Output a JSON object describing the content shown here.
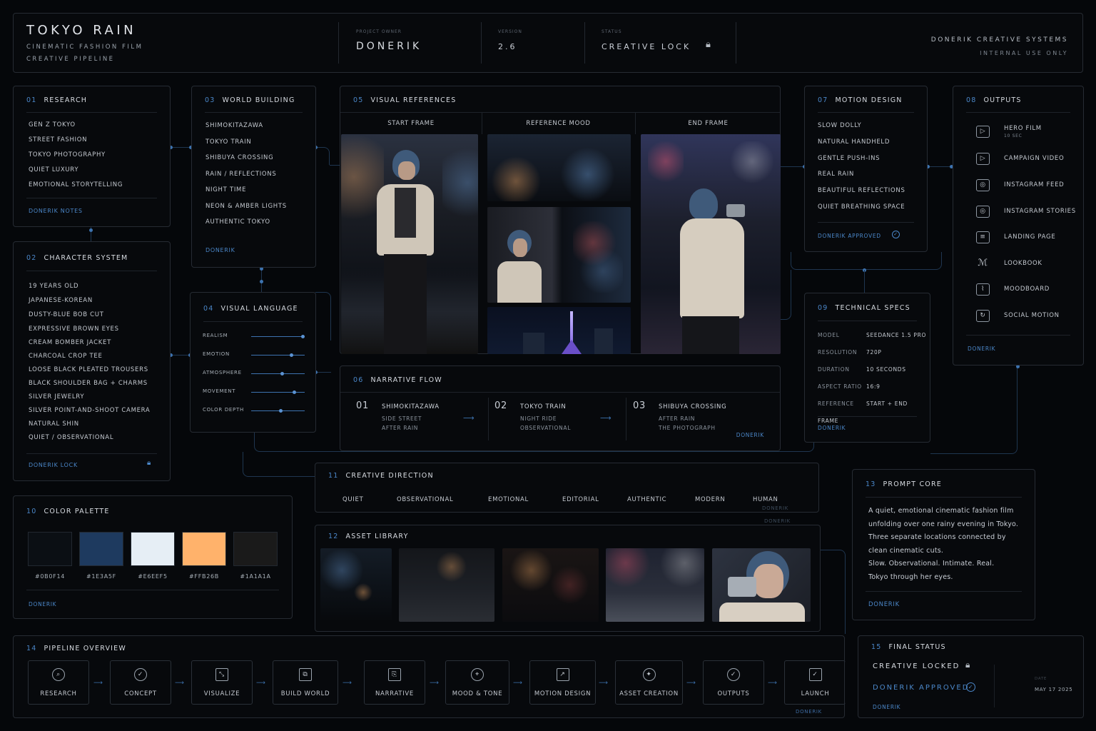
{
  "header": {
    "title": "TOKYO RAIN",
    "subtitle1": "CINEMATIC FASHION FILM",
    "subtitle2": "CREATIVE PIPELINE",
    "owner_label": "PROJECT OWNER",
    "owner": "DONERIK",
    "version_label": "VERSION",
    "version": "2.6",
    "status_label": "STATUS",
    "status": "CREATIVE LOCK",
    "org": "DONERIK CREATIVE SYSTEMS",
    "org_note": "INTERNAL USE ONLY"
  },
  "research": {
    "num": "01",
    "title": "RESEARCH",
    "items": [
      "GEN Z TOKYO",
      "STREET FASHION",
      "TOKYO PHOTOGRAPHY",
      "QUIET LUXURY",
      "EMOTIONAL STORYTELLING"
    ],
    "footer": "DONERIK NOTES"
  },
  "character": {
    "num": "02",
    "title": "CHARACTER SYSTEM",
    "items": [
      "19 YEARS OLD",
      "JAPANESE-KOREAN",
      "DUSTY-BLUE BOB CUT",
      "EXPRESSIVE BROWN EYES",
      "CREAM BOMBER JACKET",
      "CHARCOAL CROP TEE",
      "LOOSE BLACK PLEATED TROUSERS",
      "BLACK SHOULDER BAG + CHARMS",
      "SILVER JEWELRY",
      "SILVER POINT-AND-SHOOT CAMERA",
      "NATURAL SHIN",
      "QUIET / OBSERVATIONAL"
    ],
    "footer": "DONERIK LOCK"
  },
  "world": {
    "num": "03",
    "title": "WORLD BUILDING",
    "items": [
      "SHIMOKITAZAWA",
      "TOKYO TRAIN",
      "SHIBUYA CROSSING",
      "RAIN / REFLECTIONS",
      "NIGHT TIME",
      "NEON & AMBER LIGHTS",
      "AUTHENTIC TOKYO"
    ],
    "footer": "DONERIK"
  },
  "visual_language": {
    "num": "04",
    "title": "VISUAL LANGUAGE",
    "sliders": [
      {
        "label": "REALISM",
        "value": 0.97
      },
      {
        "label": "EMOTION",
        "value": 0.75
      },
      {
        "label": "ATMOSPHERE",
        "value": 0.58
      },
      {
        "label": "MOVEMENT",
        "value": 0.8
      },
      {
        "label": "COLOR DEPTH",
        "value": 0.55
      }
    ]
  },
  "visual_refs": {
    "num": "05",
    "title": "VISUAL REFERENCES",
    "col1": "START FRAME",
    "col2": "REFERENCE MOOD",
    "col3": "END FRAME"
  },
  "narrative": {
    "num": "06",
    "title": "NARRATIVE FLOW",
    "steps": [
      {
        "n": "01",
        "title": "SHIMOKITAZAWA",
        "l1": "SIDE STREET",
        "l2": "AFTER RAIN"
      },
      {
        "n": "02",
        "title": "TOKYO TRAIN",
        "l1": "NIGHT RIDE",
        "l2": "OBSERVATIONAL"
      },
      {
        "n": "03",
        "title": "SHIBUYA CROSSING",
        "l1": "AFTER RAIN",
        "l2": "THE PHOTOGRAPH"
      }
    ],
    "footer": "DONERIK"
  },
  "motion": {
    "num": "07",
    "title": "MOTION DESIGN",
    "items": [
      "SLOW DOLLY",
      "NATURAL HANDHELD",
      "GENTLE PUSH-INS",
      "REAL RAIN",
      "BEAUTIFUL REFLECTIONS",
      "QUIET BREATHING SPACE"
    ],
    "footer": "DONERIK APPROVED"
  },
  "outputs": {
    "num": "08",
    "title": "OUTPUTS",
    "items": [
      {
        "label": "HERO FILM",
        "sub": "10 SEC",
        "icon": "play-icon"
      },
      {
        "label": "CAMPAIGN VIDEO",
        "sub": "",
        "icon": "play-icon"
      },
      {
        "label": "INSTAGRAM FEED",
        "sub": "",
        "icon": "instagram-icon"
      },
      {
        "label": "INSTAGRAM STORIES",
        "sub": "",
        "icon": "instagram-icon"
      },
      {
        "label": "LANDING PAGE",
        "sub": "",
        "icon": "browser-icon"
      },
      {
        "label": "LOOKBOOK",
        "sub": "",
        "icon": "book-icon"
      },
      {
        "label": "MOODBOARD",
        "sub": "",
        "icon": "image-icon"
      },
      {
        "label": "SOCIAL MOTION",
        "sub": "",
        "icon": "share-icon"
      }
    ],
    "footer": "DONERIK"
  },
  "specs": {
    "num": "09",
    "title": "TECHNICAL SPECS",
    "rows": [
      {
        "k": "MODEL",
        "v": "SEEDANCE 1.5 PRO"
      },
      {
        "k": "RESOLUTION",
        "v": "720P"
      },
      {
        "k": "DURATION",
        "v": "10 SECONDS"
      },
      {
        "k": "ASPECT RATIO",
        "v": "16:9"
      },
      {
        "k": "REFERENCE",
        "v": "START + END FRAME"
      }
    ],
    "footer": "DONERIK"
  },
  "palette": {
    "num": "10",
    "title": "COLOR PALETTE",
    "colors": [
      "#0B0F14",
      "#1E3A5F",
      "#E6EEF5",
      "#FFB26B",
      "#1A1A1A"
    ],
    "labels": [
      "#0B0F14",
      "#1E3A5F",
      "#E6EEF5",
      "#FFB26B",
      "#1A1A1A"
    ],
    "footer": "DONERIK"
  },
  "direction": {
    "num": "11",
    "title": "CREATIVE DIRECTION",
    "chips": [
      "QUIET",
      "OBSERVATIONAL",
      "EMOTIONAL",
      "EDITORIAL",
      "AUTHENTIC",
      "MODERN",
      "HUMAN"
    ],
    "footer": "DONERIK",
    "footer2": "DONERIK"
  },
  "assets": {
    "num": "12",
    "title": "ASSET LIBRARY"
  },
  "prompt": {
    "num": "13",
    "title": "PROMPT CORE",
    "lines": [
      "A quiet, emotional cinematic fashion film",
      "unfolding over one rainy evening in Tokyo.",
      "Three separate locations connected by",
      "clean cinematic cuts.",
      "Slow. Observational. Intimate. Real.",
      "Tokyo through her eyes."
    ],
    "footer": "DONERIK"
  },
  "pipeline": {
    "num": "14",
    "title": "PIPELINE OVERVIEW",
    "steps": [
      "RESEARCH",
      "CONCEPT",
      "VISUALIZE",
      "BUILD WORLD",
      "NARRATIVE",
      "MOOD & TONE",
      "MOTION DESIGN",
      "ASSET CREATION",
      "OUTPUTS",
      "LAUNCH"
    ],
    "footer": "DONERIK"
  },
  "final": {
    "num": "15",
    "title": "FINAL STATUS",
    "locked": "CREATIVE LOCKED",
    "approved": "DONERIK APPROVED",
    "footer": "DONERIK",
    "date_label": "DATE",
    "date": "MAY 17 2025"
  }
}
